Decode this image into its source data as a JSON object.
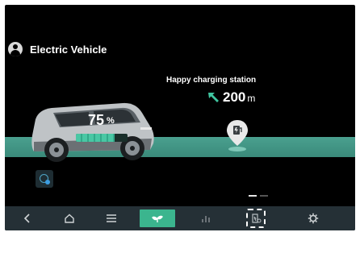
{
  "profile": {
    "name": "Electric Vehicle"
  },
  "station": {
    "name": "Happy charging station",
    "distance_value": "200",
    "distance_unit": "m"
  },
  "battery": {
    "percent_value": "75",
    "percent_sign": "%",
    "level": 0.75
  },
  "navbar": {
    "items": [
      {
        "icon": "back-icon"
      },
      {
        "icon": "home-icon"
      },
      {
        "icon": "menu-icon"
      },
      {
        "icon": "eco-leaf-icon",
        "active": true
      },
      {
        "icon": "stats-icon"
      },
      {
        "icon": "charging-settings-icon",
        "selected": true
      },
      {
        "icon": "gear-icon"
      }
    ]
  },
  "colors": {
    "accent": "#3bb58e",
    "road": "#4aa08f",
    "navbar": "#253036",
    "background": "#000000"
  },
  "page_indicator": {
    "current": 1,
    "total": 2
  }
}
